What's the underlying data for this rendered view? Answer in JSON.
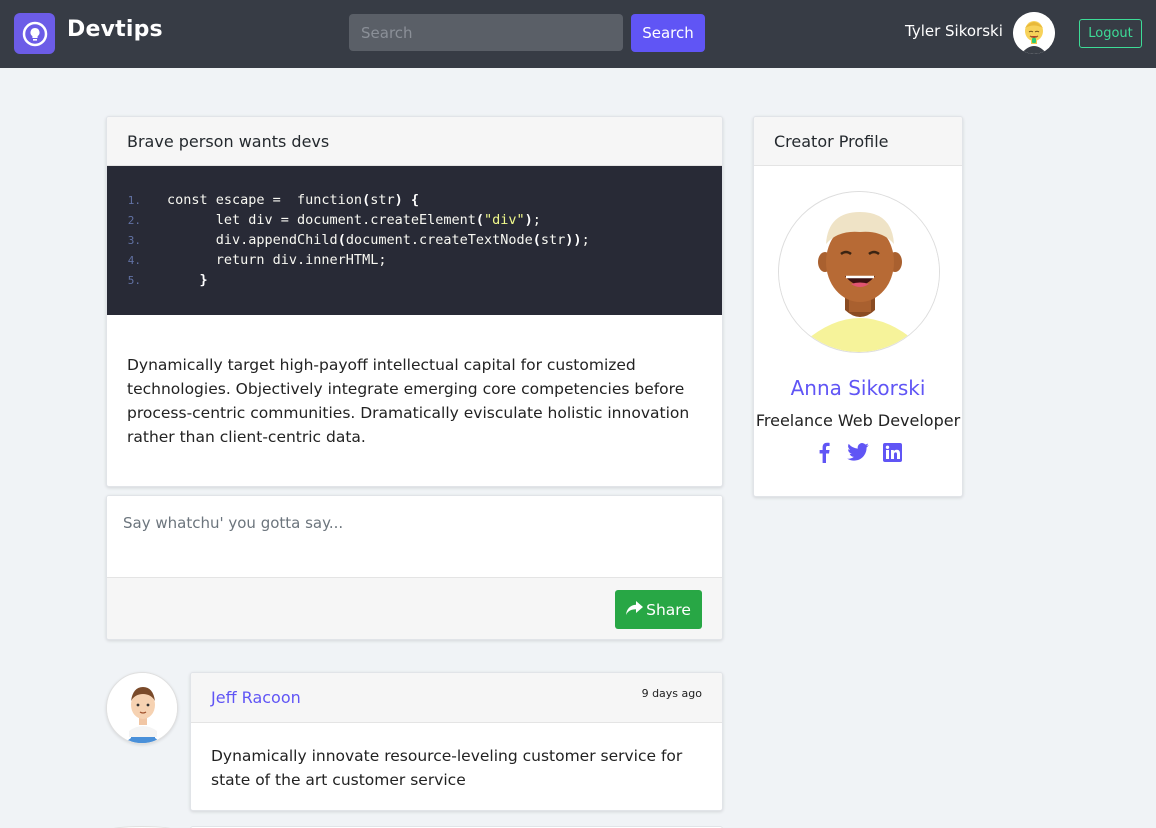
{
  "navbar": {
    "brand": "Devtips",
    "search_placeholder": "Search",
    "search_button": "Search",
    "user_name": "Tyler Sikorski",
    "logout": "Logout"
  },
  "post": {
    "title": "Brave person wants devs",
    "code": {
      "line_numbers": [
        "1.",
        "2.",
        "3.",
        "4.",
        "5."
      ],
      "lines": [
        "const escape =  function(str) {",
        "      let div = document.createElement(\"div\");",
        "      div.appendChild(document.createTextNode(str));",
        "      return div.innerHTML;",
        "    }"
      ]
    },
    "body": "Dynamically target high-payoff intellectual capital for customized technologies. Objectively integrate emerging core competencies before process-centric communities. Dramatically evisculate holistic innovation rather than client-centric data."
  },
  "comment_form": {
    "placeholder": "Say whatchu' you gotta say...",
    "share_button": "Share"
  },
  "profile": {
    "header": "Creator Profile",
    "name": "Anna Sikorski",
    "title": "Freelance Web Developer",
    "social_icons": [
      "facebook-icon",
      "twitter-icon",
      "linkedin-icon"
    ]
  },
  "replies": [
    {
      "author": "Jeff Racoon",
      "time": "9 days ago",
      "body": "Dynamically innovate resource-leveling customer service for state of the art customer service"
    }
  ],
  "colors": {
    "navbar": "#373c45",
    "accent": "#6055f5",
    "logout": "#3ddc97",
    "share": "#28a745",
    "code_bg": "#282a36"
  }
}
